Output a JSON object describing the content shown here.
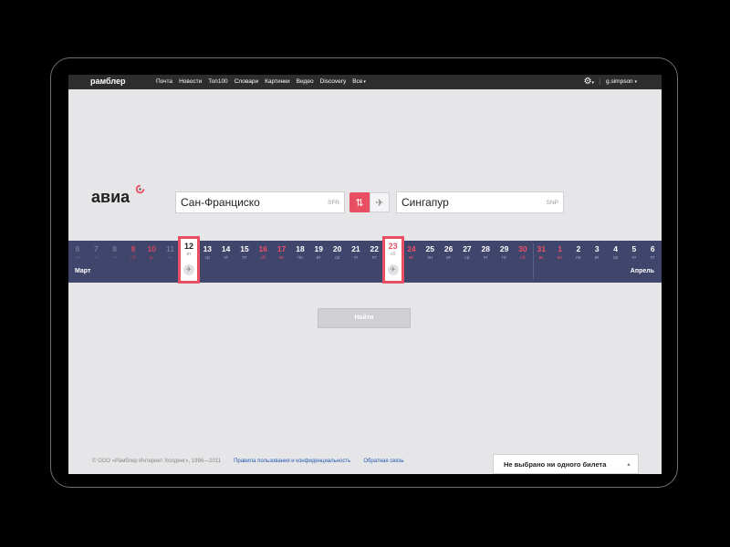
{
  "topbar": {
    "logo": "рамблер",
    "nav": [
      "Почта",
      "Новости",
      "Топ100",
      "Словари",
      "Картинки",
      "Видео",
      "Discovery",
      "Все"
    ],
    "user": "g.simpson",
    "caret": "▾"
  },
  "search": {
    "logo": "авиа",
    "from": {
      "city": "Сан-Франциско",
      "code": "SFR"
    },
    "to": {
      "city": "Сингапур",
      "code": "SNP"
    },
    "roundtrip_icon": "swap-arrows-icon",
    "oneway_icon": "plane-icon",
    "find_label": "Найти"
  },
  "calendar": {
    "months": {
      "march": "Март",
      "april": "Апрель"
    },
    "days": [
      {
        "n": "6",
        "w": "пн",
        "type": "wd",
        "past": true
      },
      {
        "n": "7",
        "w": "чт",
        "type": "wd",
        "past": true
      },
      {
        "n": "8",
        "w": "пт",
        "type": "wd",
        "past": true
      },
      {
        "n": "9",
        "w": "сб",
        "type": "we",
        "past": true
      },
      {
        "n": "10",
        "w": "вс",
        "type": "we",
        "past": true
      },
      {
        "n": "11",
        "w": "пн",
        "type": "wd",
        "past": true
      },
      {
        "n": "12",
        "w": "вт",
        "type": "sel"
      },
      {
        "n": "13",
        "w": "ср",
        "type": "wd"
      },
      {
        "n": "14",
        "w": "чт",
        "type": "wd"
      },
      {
        "n": "15",
        "w": "пт",
        "type": "wd"
      },
      {
        "n": "16",
        "w": "сб",
        "type": "we"
      },
      {
        "n": "17",
        "w": "вс",
        "type": "we"
      },
      {
        "n": "18",
        "w": "пн",
        "type": "wd"
      },
      {
        "n": "19",
        "w": "вт",
        "type": "wd"
      },
      {
        "n": "20",
        "w": "ср",
        "type": "wd"
      },
      {
        "n": "21",
        "w": "чт",
        "type": "wd"
      },
      {
        "n": "22",
        "w": "пт",
        "type": "wd"
      },
      {
        "n": "23",
        "w": "сб",
        "type": "sel-we"
      },
      {
        "n": "24",
        "w": "вс",
        "type": "we"
      },
      {
        "n": "25",
        "w": "пн",
        "type": "wd"
      },
      {
        "n": "26",
        "w": "вт",
        "type": "wd"
      },
      {
        "n": "27",
        "w": "ср",
        "type": "wd"
      },
      {
        "n": "28",
        "w": "чт",
        "type": "wd"
      },
      {
        "n": "29",
        "w": "пт",
        "type": "wd"
      },
      {
        "n": "30",
        "w": "сб",
        "type": "we"
      },
      {
        "n": "31",
        "w": "вс",
        "type": "we"
      },
      {
        "n": "1",
        "w": "вс",
        "type": "we"
      },
      {
        "n": "2",
        "w": "пн",
        "type": "wd"
      },
      {
        "n": "3",
        "w": "вт",
        "type": "wd"
      },
      {
        "n": "4",
        "w": "ср",
        "type": "wd"
      },
      {
        "n": "5",
        "w": "чт",
        "type": "wd"
      },
      {
        "n": "6",
        "w": "пт",
        "type": "wd"
      },
      {
        "n": "7",
        "w": "сб",
        "type": "we"
      }
    ]
  },
  "footer": {
    "copyright": "© ООО «Рамблер Интернет Холдинг», 1996—2011",
    "privacy": "Правила пользования и конфиденциальность",
    "feedback": "Обратная связь"
  },
  "tickets": {
    "label": "Не выбрано ни одного билета",
    "arrow": "▲"
  },
  "colors": {
    "accent": "#e94f62",
    "calendar": "#40456c",
    "topbar": "#2d2d2d"
  }
}
